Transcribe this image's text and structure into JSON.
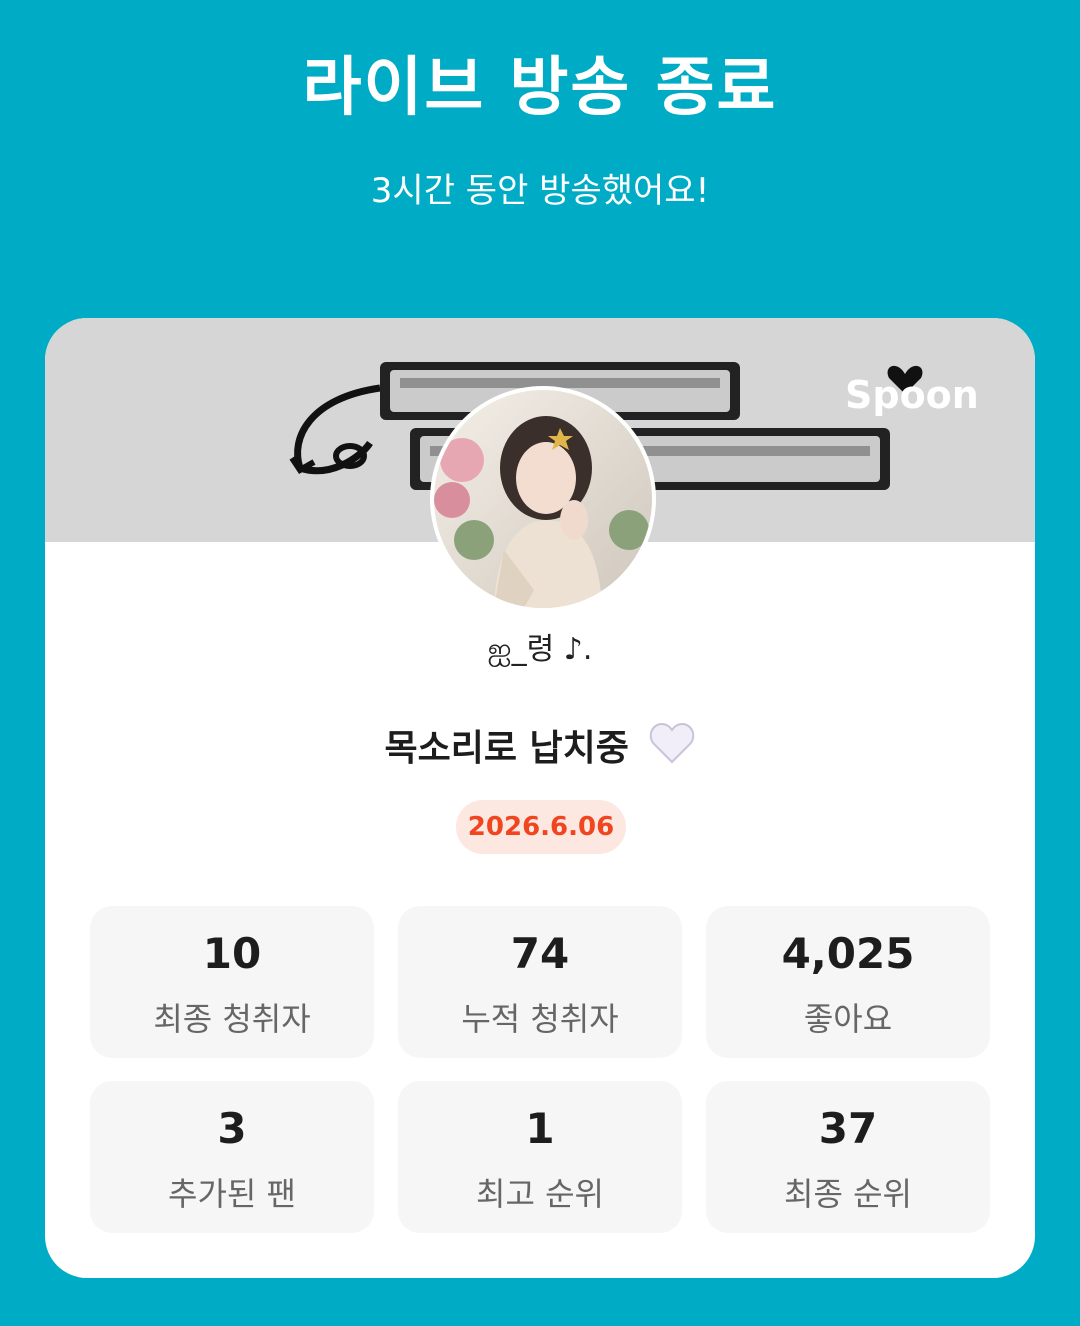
{
  "header": {
    "title": "라이브 방송 종료",
    "subtitle": "3시간 동안 방송했어요!"
  },
  "card": {
    "banner": {
      "logo_text": "Spoon",
      "logo_icon": "heart-icon",
      "background_color": "#d6d6d6"
    },
    "profile": {
      "avatar_icon": "profile-photo",
      "nickname": "ஐ_령 ♪."
    },
    "live_title": "목소리로 납치중",
    "live_title_emoji": "white-heart-icon",
    "date": "2026.6.06",
    "stats": [
      {
        "value": "10",
        "label": "최종 청취자"
      },
      {
        "value": "74",
        "label": "누적 청취자"
      },
      {
        "value": "4,025",
        "label": "좋아요"
      },
      {
        "value": "3",
        "label": "추가된 팬"
      },
      {
        "value": "1",
        "label": "최고 순위"
      },
      {
        "value": "37",
        "label": "최종 순위"
      }
    ]
  },
  "colors": {
    "background": "#00abc5",
    "card": "#ffffff",
    "date_text": "#f0451f",
    "date_badge": "#fde7e1",
    "stat_box": "#f6f6f6"
  }
}
